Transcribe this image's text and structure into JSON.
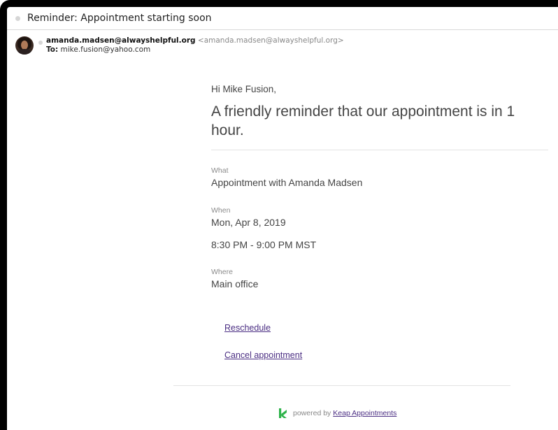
{
  "subject": "Reminder: Appointment starting soon",
  "sender": {
    "name": "amanda.madsen@alwayshelpful.org",
    "address": "<amanda.madsen@alwayshelpful.org>",
    "to_label": "To:",
    "to_value": "mike.fusion@yahoo.com"
  },
  "body": {
    "greeting": "Hi Mike Fusion,",
    "headline": "A friendly reminder that our appointment is in 1 hour.",
    "what_label": "What",
    "what_value": "Appointment with Amanda Madsen",
    "when_label": "When",
    "when_date": "Mon, Apr 8, 2019",
    "when_time": "8:30 PM - 9:00 PM MST",
    "where_label": "Where",
    "where_value": "Main office",
    "reschedule_link": "Reschedule",
    "cancel_link": "Cancel appointment"
  },
  "footer": {
    "powered_by": "powered by",
    "link": "Keap Appointments",
    "brand_color": "#2db34a"
  },
  "colors": {
    "link": "#4b2e83",
    "text": "#444444"
  }
}
